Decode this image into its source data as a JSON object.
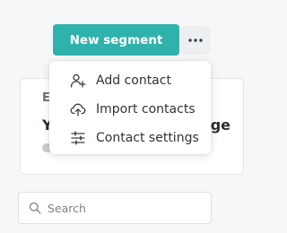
{
  "toolbar": {
    "new_segment_label": "New segment",
    "more_icon": "ellipsis-icon"
  },
  "card": {
    "label_fragment": "E",
    "title_left_fragment": "Y",
    "title_right_fragment": "age"
  },
  "menu": {
    "items": [
      {
        "label": "Add contact",
        "icon": "add-user-icon"
      },
      {
        "label": "Import contacts",
        "icon": "cloud-upload-icon"
      },
      {
        "label": "Contact settings",
        "icon": "sliders-icon"
      }
    ]
  },
  "search": {
    "placeholder": "Search",
    "value": ""
  },
  "colors": {
    "accent": "#2fb2ad",
    "background": "#f6f7f8"
  }
}
